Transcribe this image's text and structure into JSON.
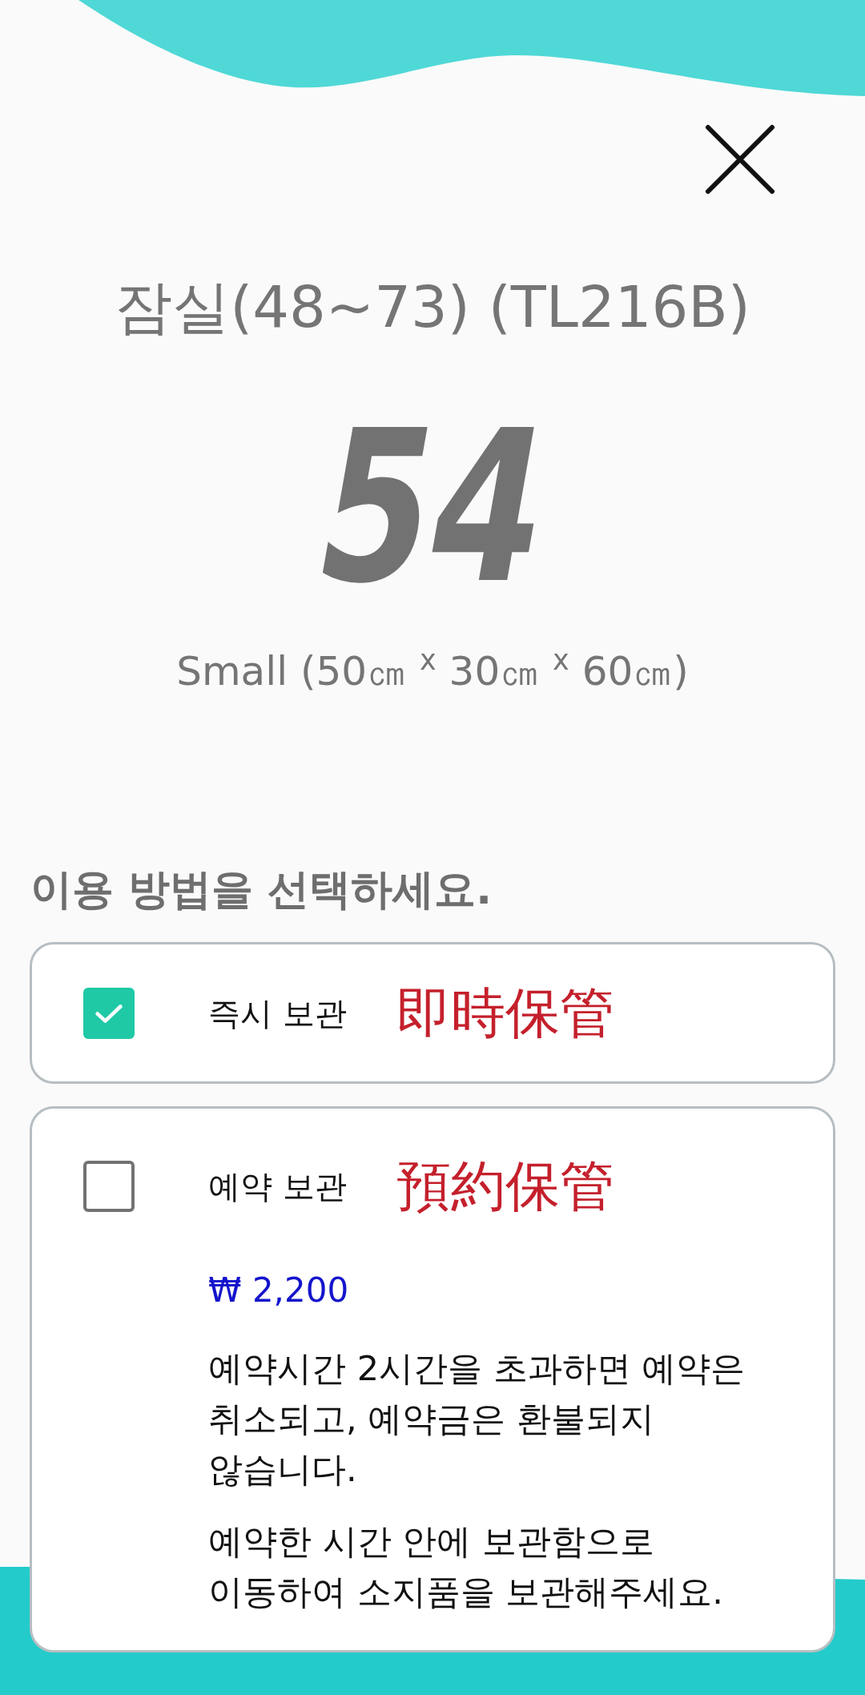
{
  "locker": {
    "location": "잠실(48~73) (TL216B)",
    "number": "54",
    "size": "Small (50㎝ $^{x}$ 30㎝ $^{x}$ 60㎝)"
  },
  "prompt": "이용 방법을 선택하세요.",
  "options": [
    {
      "label": "즉시 보관",
      "annotation": "即時保管",
      "checked": true
    },
    {
      "label": "예약 보관",
      "annotation": "預約保管",
      "checked": false,
      "price": "₩ 2,200",
      "notes": [
        "예약시간 2시간을 초과하면 예약은 취소되고, 예약금은 환불되지 않습니다.",
        "예약한 시간 안에 보관함으로 이동하여 소지품을 보관해주세요."
      ]
    }
  ]
}
